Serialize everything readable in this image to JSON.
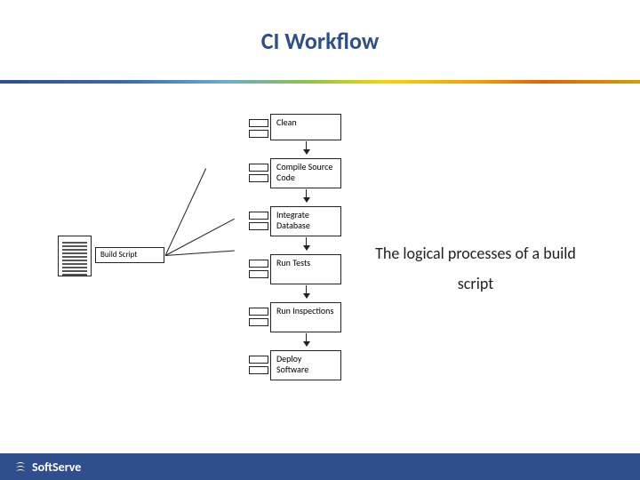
{
  "title": "CI Workflow",
  "build_script_label": "Build Script",
  "steps": [
    {
      "label": "Clean"
    },
    {
      "label": "Compile Source Code"
    },
    {
      "label": "Integrate Database"
    },
    {
      "label": "Run Tests"
    },
    {
      "label": "Run Inspections"
    },
    {
      "label": "Deploy Software"
    }
  ],
  "caption": "The logical processes of a build script",
  "brand": "SoftServe"
}
